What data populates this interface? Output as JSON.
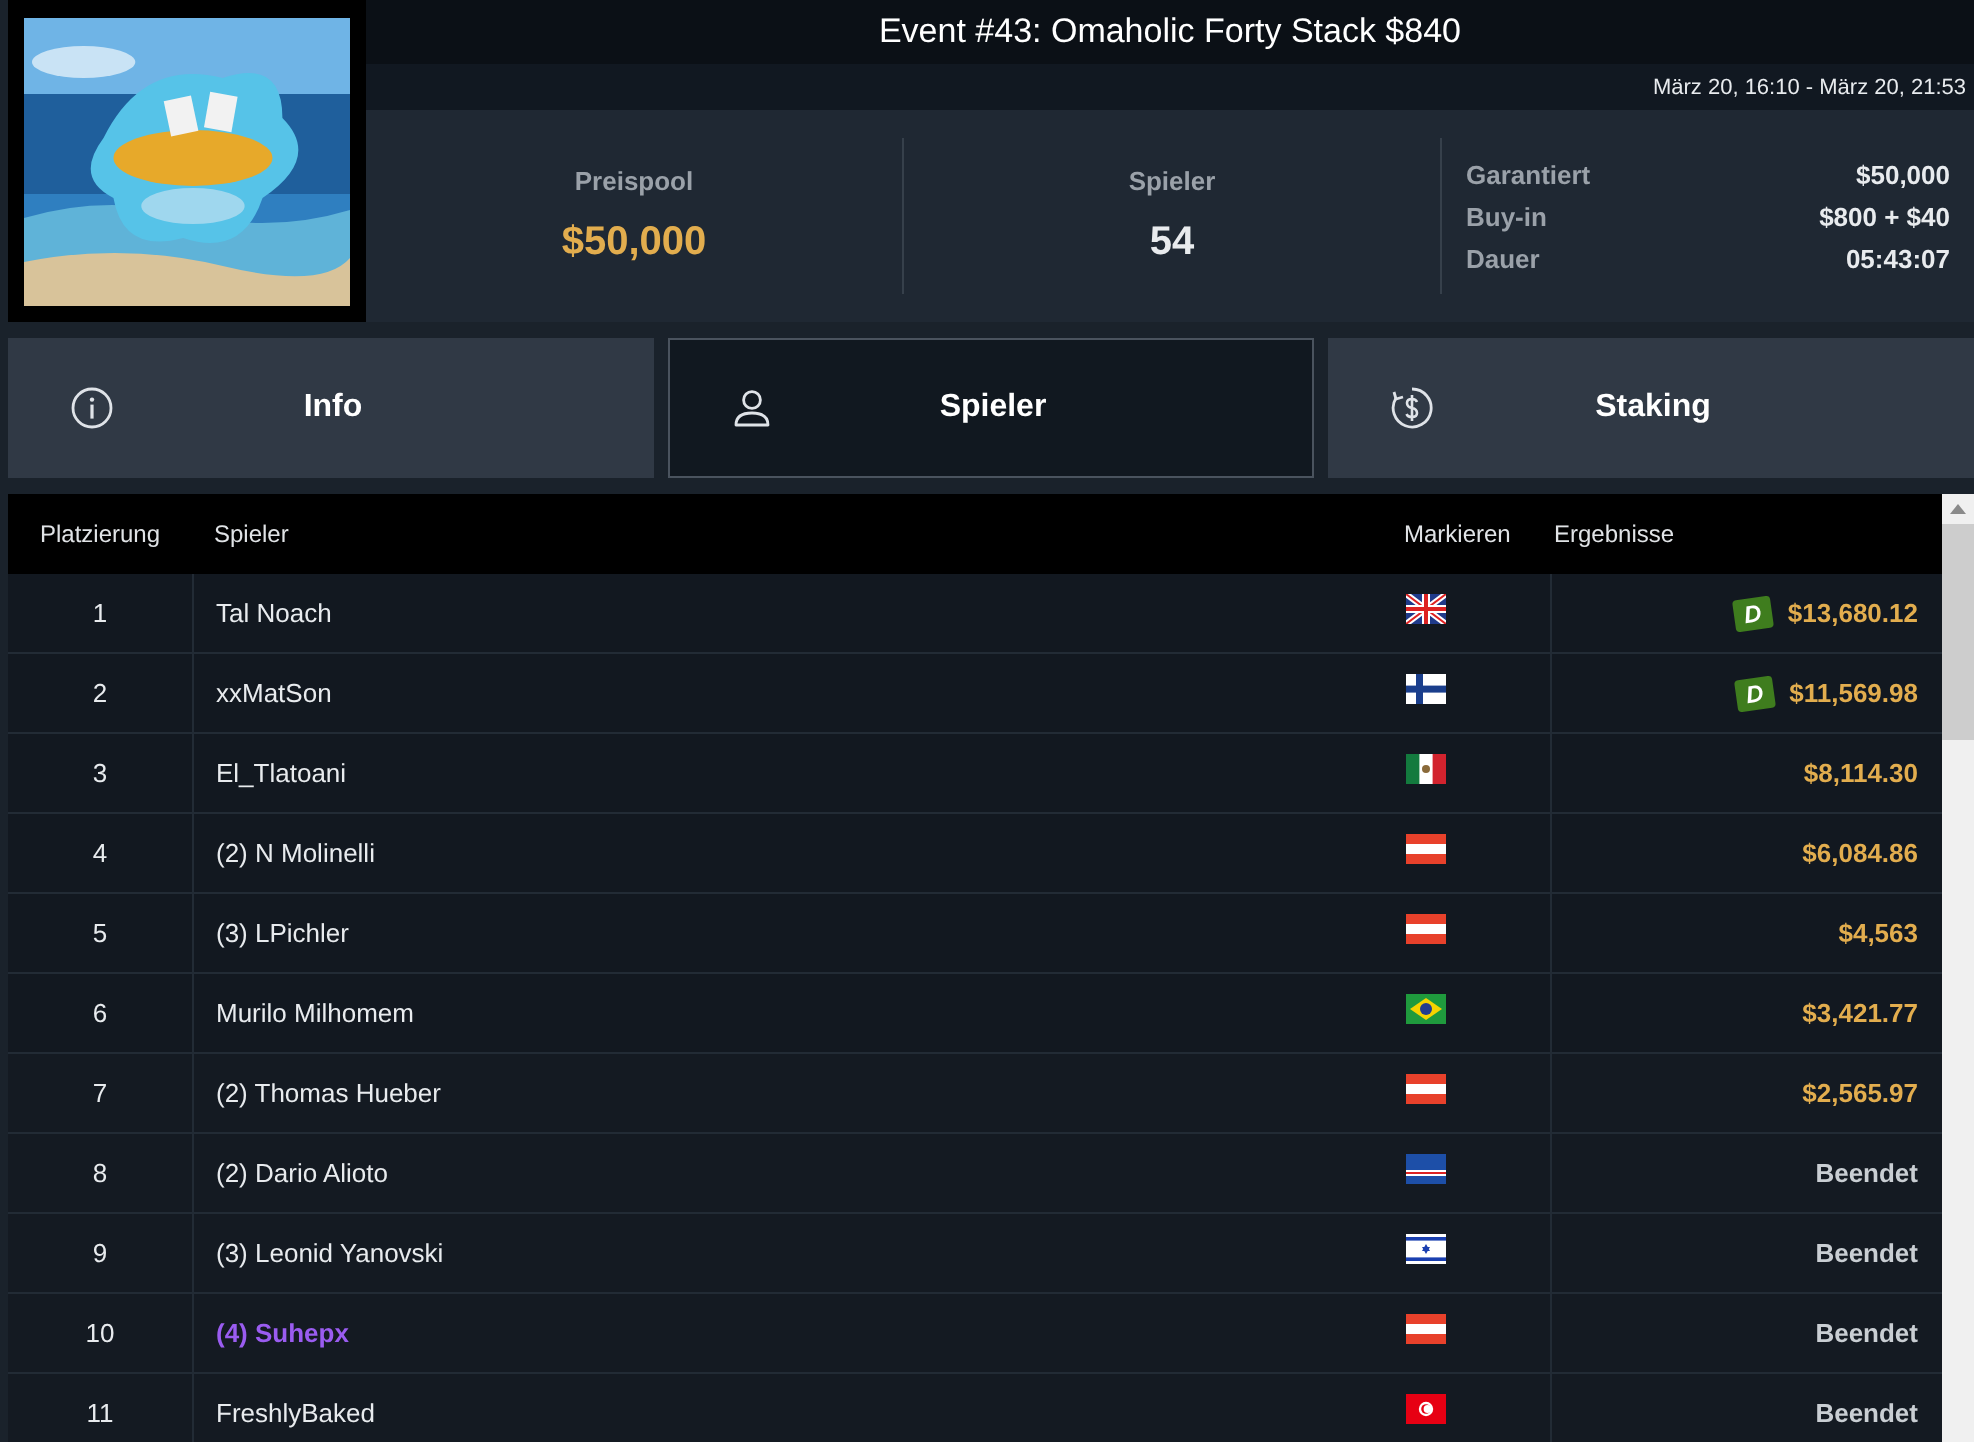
{
  "header": {
    "title": "Event #43: Omaholic Forty Stack $840",
    "dates": "März 20, 16:10 - März 20, 21:53"
  },
  "stats": [
    {
      "label": "Preispool",
      "value": "$50,000",
      "kind": "money"
    },
    {
      "label": "Spieler",
      "value": "54",
      "kind": "plain"
    }
  ],
  "details": [
    {
      "label": "Garantiert",
      "value": "$50,000"
    },
    {
      "label": "Buy-in",
      "value": "$800 + $40"
    },
    {
      "label": "Dauer",
      "value": "05:43:07"
    }
  ],
  "tabs": [
    {
      "label": "Info",
      "kind": "info",
      "selected": false
    },
    {
      "label": "Spieler",
      "kind": "user",
      "selected": true
    },
    {
      "label": "Staking",
      "kind": "dollar",
      "selected": false
    }
  ],
  "table": {
    "columns": [
      "Platzierung",
      "Spieler",
      "Markieren",
      "Ergebnisse"
    ],
    "rows": [
      {
        "rank": "1",
        "name": "Tal Noach",
        "highlighted": false,
        "flag": {
          "kind": "gb"
        },
        "badge": "D",
        "result": {
          "text": "$13,680.12",
          "kind": "prize"
        }
      },
      {
        "rank": "2",
        "name": "xxMatSon",
        "highlighted": false,
        "flag": {
          "kind": "fi"
        },
        "badge": "D",
        "result": {
          "text": "$11,569.98",
          "kind": "prize"
        }
      },
      {
        "rank": "3",
        "name": "El_Tlatoani",
        "highlighted": false,
        "flag": {
          "kind": "mx"
        },
        "result": {
          "text": "$8,114.30",
          "kind": "prize"
        }
      },
      {
        "rank": "4",
        "name": "(2) N Molinelli",
        "highlighted": false,
        "flag": {
          "kind": "at"
        },
        "result": {
          "text": "$6,084.86",
          "kind": "prize"
        }
      },
      {
        "rank": "5",
        "name": "(3) LPichler",
        "highlighted": false,
        "flag": {
          "kind": "at"
        },
        "result": {
          "text": "$4,563",
          "kind": "prize"
        }
      },
      {
        "rank": "6",
        "name": "Murilo Milhomem",
        "highlighted": false,
        "flag": {
          "kind": "br"
        },
        "result": {
          "text": "$3,421.77",
          "kind": "prize"
        }
      },
      {
        "rank": "7",
        "name": "(2) Thomas Hueber",
        "highlighted": false,
        "flag": {
          "kind": "at"
        },
        "result": {
          "text": "$2,565.97",
          "kind": "prize"
        }
      },
      {
        "rank": "8",
        "name": "(2) Dario Alioto",
        "highlighted": false,
        "flag": {
          "kind": "cv"
        },
        "result": {
          "text": "Beendet",
          "kind": "out"
        }
      },
      {
        "rank": "9",
        "name": "(3) Leonid Yanovski",
        "highlighted": false,
        "flag": {
          "kind": "il"
        },
        "result": {
          "text": "Beendet",
          "kind": "out"
        }
      },
      {
        "rank": "10",
        "name": "(4) Suhepx",
        "highlighted": true,
        "flag": {
          "kind": "at"
        },
        "result": {
          "text": "Beendet",
          "kind": "out"
        }
      },
      {
        "rank": "11",
        "name": "FreshlyBaked",
        "highlighted": false,
        "flag": {
          "kind": "tn"
        },
        "result": {
          "text": "Beendet",
          "kind": "out"
        }
      }
    ]
  }
}
